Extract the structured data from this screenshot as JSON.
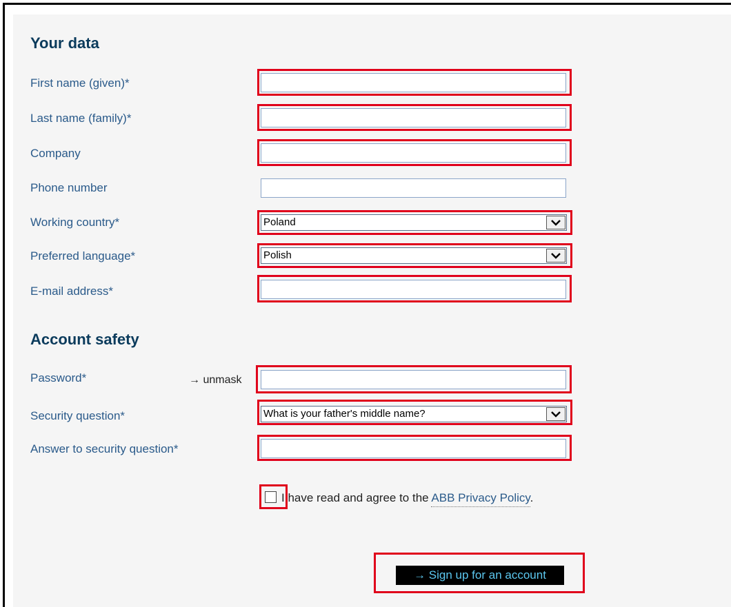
{
  "sections": {
    "your_data": "Your data",
    "account_safety": "Account safety"
  },
  "fields": {
    "first_name": {
      "label": "First name (given)*",
      "value": ""
    },
    "last_name": {
      "label": "Last name (family)*",
      "value": ""
    },
    "company": {
      "label": "Company",
      "value": ""
    },
    "phone": {
      "label": "Phone number",
      "value": ""
    },
    "country": {
      "label": "Working country*",
      "value": "Poland"
    },
    "language": {
      "label": "Preferred language*",
      "value": "Polish"
    },
    "email": {
      "label": "E-mail address*",
      "value": ""
    },
    "password": {
      "label": "Password*",
      "unmask": "→ unmask",
      "value": ""
    },
    "security_question": {
      "label": "Security question*",
      "value": "What is your father's middle name?"
    },
    "answer": {
      "label": "Answer to security question*",
      "value": ""
    }
  },
  "agreement": {
    "text": "I have read and agree to the ",
    "link": "ABB Privacy Policy",
    "suffix": ".",
    "checked": false
  },
  "submit": {
    "label": "→ Sign up for an account"
  },
  "colors": {
    "highlight": "#e0001b",
    "label": "#2a5a8a",
    "heading": "#0b3b5c",
    "button_bg": "#000000",
    "button_text": "#5cc8f0"
  },
  "icons": {
    "dropdown": "chevron-down-icon"
  }
}
